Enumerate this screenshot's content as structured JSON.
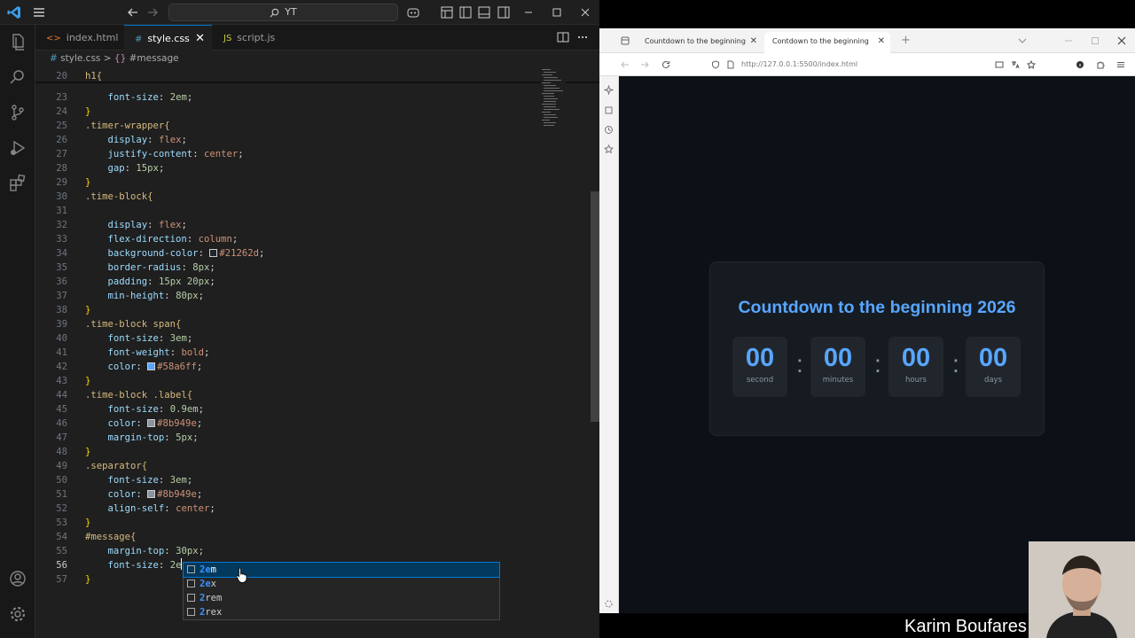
{
  "vscode": {
    "command_center": "YT",
    "tabs": [
      {
        "icon": "<>",
        "label": "index.html"
      },
      {
        "icon": "#",
        "label": "style.css"
      },
      {
        "icon": "JS",
        "label": "script.js"
      }
    ],
    "breadcrumb": {
      "file": "style.css",
      "sep": ">",
      "symbol": "#message"
    },
    "lines": [
      {
        "n": "20",
        "code": [
          {
            "t": "h1{",
            "c": "sel"
          }
        ]
      },
      {
        "n": "23",
        "code": [
          {
            "t": "    ",
            "c": "pc"
          },
          {
            "t": "font-size",
            "c": "prop"
          },
          {
            "t": ": ",
            "c": "pc"
          },
          {
            "t": "2em",
            "c": "num"
          },
          {
            "t": ";",
            "c": "pc"
          }
        ]
      },
      {
        "n": "24",
        "code": [
          {
            "t": "}",
            "c": "br"
          }
        ]
      },
      {
        "n": "25",
        "code": [
          {
            "t": ".timer-wrapper{",
            "c": "sel"
          }
        ]
      },
      {
        "n": "26",
        "code": [
          {
            "t": "    ",
            "c": "pc"
          },
          {
            "t": "display",
            "c": "prop"
          },
          {
            "t": ": ",
            "c": "pc"
          },
          {
            "t": "flex",
            "c": "val"
          },
          {
            "t": ";",
            "c": "pc"
          }
        ]
      },
      {
        "n": "27",
        "code": [
          {
            "t": "    ",
            "c": "pc"
          },
          {
            "t": "justify-content",
            "c": "prop"
          },
          {
            "t": ": ",
            "c": "pc"
          },
          {
            "t": "center",
            "c": "val"
          },
          {
            "t": ";",
            "c": "pc"
          }
        ]
      },
      {
        "n": "28",
        "code": [
          {
            "t": "    ",
            "c": "pc"
          },
          {
            "t": "gap",
            "c": "prop"
          },
          {
            "t": ": ",
            "c": "pc"
          },
          {
            "t": "15px",
            "c": "num"
          },
          {
            "t": ";",
            "c": "pc"
          }
        ]
      },
      {
        "n": "29",
        "code": [
          {
            "t": "}",
            "c": "br"
          }
        ]
      },
      {
        "n": "30",
        "code": [
          {
            "t": ".time-block{",
            "c": "sel"
          }
        ]
      },
      {
        "n": "31",
        "code": []
      },
      {
        "n": "32",
        "code": [
          {
            "t": "    ",
            "c": "pc"
          },
          {
            "t": "display",
            "c": "prop"
          },
          {
            "t": ": ",
            "c": "pc"
          },
          {
            "t": "flex",
            "c": "val"
          },
          {
            "t": ";",
            "c": "pc"
          }
        ]
      },
      {
        "n": "33",
        "code": [
          {
            "t": "    ",
            "c": "pc"
          },
          {
            "t": "flex-direction",
            "c": "prop"
          },
          {
            "t": ": ",
            "c": "pc"
          },
          {
            "t": "column",
            "c": "val"
          },
          {
            "t": ";",
            "c": "pc"
          }
        ]
      },
      {
        "n": "34",
        "code": [
          {
            "t": "    ",
            "c": "pc"
          },
          {
            "t": "background-color",
            "c": "prop"
          },
          {
            "t": ": ",
            "c": "pc"
          },
          {
            "sw": "#21262d"
          },
          {
            "t": "#21262d",
            "c": "val"
          },
          {
            "t": ";",
            "c": "pc"
          }
        ]
      },
      {
        "n": "35",
        "code": [
          {
            "t": "    ",
            "c": "pc"
          },
          {
            "t": "border-radius",
            "c": "prop"
          },
          {
            "t": ": ",
            "c": "pc"
          },
          {
            "t": "8px",
            "c": "num"
          },
          {
            "t": ";",
            "c": "pc"
          }
        ]
      },
      {
        "n": "36",
        "code": [
          {
            "t": "    ",
            "c": "pc"
          },
          {
            "t": "padding",
            "c": "prop"
          },
          {
            "t": ": ",
            "c": "pc"
          },
          {
            "t": "15px 20px",
            "c": "num"
          },
          {
            "t": ";",
            "c": "pc"
          }
        ]
      },
      {
        "n": "37",
        "code": [
          {
            "t": "    ",
            "c": "pc"
          },
          {
            "t": "min-height",
            "c": "prop"
          },
          {
            "t": ": ",
            "c": "pc"
          },
          {
            "t": "80px",
            "c": "num"
          },
          {
            "t": ";",
            "c": "pc"
          }
        ]
      },
      {
        "n": "38",
        "code": [
          {
            "t": "}",
            "c": "br"
          }
        ]
      },
      {
        "n": "39",
        "code": [
          {
            "t": ".time-block span{",
            "c": "sel"
          }
        ]
      },
      {
        "n": "40",
        "code": [
          {
            "t": "    ",
            "c": "pc"
          },
          {
            "t": "font-size",
            "c": "prop"
          },
          {
            "t": ": ",
            "c": "pc"
          },
          {
            "t": "3em",
            "c": "num"
          },
          {
            "t": ";",
            "c": "pc"
          }
        ]
      },
      {
        "n": "41",
        "code": [
          {
            "t": "    ",
            "c": "pc"
          },
          {
            "t": "font-weight",
            "c": "prop"
          },
          {
            "t": ": ",
            "c": "pc"
          },
          {
            "t": "bold",
            "c": "val"
          },
          {
            "t": ";",
            "c": "pc"
          }
        ]
      },
      {
        "n": "42",
        "code": [
          {
            "t": "    ",
            "c": "pc"
          },
          {
            "t": "color",
            "c": "prop"
          },
          {
            "t": ": ",
            "c": "pc"
          },
          {
            "sw": "#58a6ff"
          },
          {
            "t": "#58a6ff",
            "c": "val"
          },
          {
            "t": ";",
            "c": "pc"
          }
        ]
      },
      {
        "n": "43",
        "code": [
          {
            "t": "}",
            "c": "br"
          }
        ]
      },
      {
        "n": "44",
        "code": [
          {
            "t": ".time-block .label{",
            "c": "sel"
          }
        ]
      },
      {
        "n": "45",
        "code": [
          {
            "t": "    ",
            "c": "pc"
          },
          {
            "t": "font-size",
            "c": "prop"
          },
          {
            "t": ": ",
            "c": "pc"
          },
          {
            "t": "0.9em",
            "c": "num"
          },
          {
            "t": ";",
            "c": "pc"
          }
        ]
      },
      {
        "n": "46",
        "code": [
          {
            "t": "    ",
            "c": "pc"
          },
          {
            "t": "color",
            "c": "prop"
          },
          {
            "t": ": ",
            "c": "pc"
          },
          {
            "sw": "#8b949e"
          },
          {
            "t": "#8b949e",
            "c": "val"
          },
          {
            "t": ";",
            "c": "pc"
          }
        ]
      },
      {
        "n": "47",
        "code": [
          {
            "t": "    ",
            "c": "pc"
          },
          {
            "t": "margin-top",
            "c": "prop"
          },
          {
            "t": ": ",
            "c": "pc"
          },
          {
            "t": "5px",
            "c": "num"
          },
          {
            "t": ";",
            "c": "pc"
          }
        ]
      },
      {
        "n": "48",
        "code": [
          {
            "t": "}",
            "c": "br"
          }
        ]
      },
      {
        "n": "49",
        "code": [
          {
            "t": ".separator{",
            "c": "sel"
          }
        ]
      },
      {
        "n": "50",
        "code": [
          {
            "t": "    ",
            "c": "pc"
          },
          {
            "t": "font-size",
            "c": "prop"
          },
          {
            "t": ": ",
            "c": "pc"
          },
          {
            "t": "3em",
            "c": "num"
          },
          {
            "t": ";",
            "c": "pc"
          }
        ]
      },
      {
        "n": "51",
        "code": [
          {
            "t": "    ",
            "c": "pc"
          },
          {
            "t": "color",
            "c": "prop"
          },
          {
            "t": ": ",
            "c": "pc"
          },
          {
            "sw": "#8b949e"
          },
          {
            "t": "#8b949e",
            "c": "val"
          },
          {
            "t": ";",
            "c": "pc"
          }
        ]
      },
      {
        "n": "52",
        "code": [
          {
            "t": "    ",
            "c": "pc"
          },
          {
            "t": "align-self",
            "c": "prop"
          },
          {
            "t": ": ",
            "c": "pc"
          },
          {
            "t": "center",
            "c": "val"
          },
          {
            "t": ";",
            "c": "pc"
          }
        ]
      },
      {
        "n": "53",
        "code": [
          {
            "t": "}",
            "c": "br"
          }
        ]
      },
      {
        "n": "54",
        "code": [
          {
            "t": "#message{",
            "c": "sel"
          }
        ]
      },
      {
        "n": "55",
        "code": [
          {
            "t": "    ",
            "c": "pc"
          },
          {
            "t": "margin-top",
            "c": "prop"
          },
          {
            "t": ": ",
            "c": "pc"
          },
          {
            "t": "30px",
            "c": "num"
          },
          {
            "t": ";",
            "c": "pc"
          }
        ]
      },
      {
        "n": "56",
        "code": [
          {
            "t": "    ",
            "c": "pc"
          },
          {
            "t": "font-size",
            "c": "prop"
          },
          {
            "t": ": ",
            "c": "pc"
          },
          {
            "t": "2e",
            "c": "num"
          }
        ],
        "current": true
      },
      {
        "n": "57",
        "code": [
          {
            "t": "}",
            "c": "br"
          }
        ]
      }
    ],
    "suggestions": [
      {
        "match": "2e",
        "rest": "m"
      },
      {
        "match": "2e",
        "rest": "x"
      },
      {
        "match": "2",
        "rest": "rem"
      },
      {
        "match": "2",
        "rest": "rex"
      }
    ]
  },
  "browser": {
    "tabs": [
      {
        "label": "Countdown to the beginning"
      },
      {
        "label": "Contdown to the beginning"
      }
    ],
    "url": "http://127.0.0.1:5500/index.html",
    "page": {
      "title": "Countdown to the beginning 2026",
      "blocks": [
        {
          "value": "00",
          "label": "second"
        },
        {
          "value": "00",
          "label": "minutes"
        },
        {
          "value": "00",
          "label": "hours"
        },
        {
          "value": "00",
          "label": "days"
        }
      ],
      "separator": ":"
    },
    "colors": {
      "accent": "#58a6ff",
      "muted": "#8b949e",
      "card": "#161b22",
      "block": "#21262d",
      "bg": "#0d1117"
    }
  },
  "presenter": "Karim Boufares"
}
